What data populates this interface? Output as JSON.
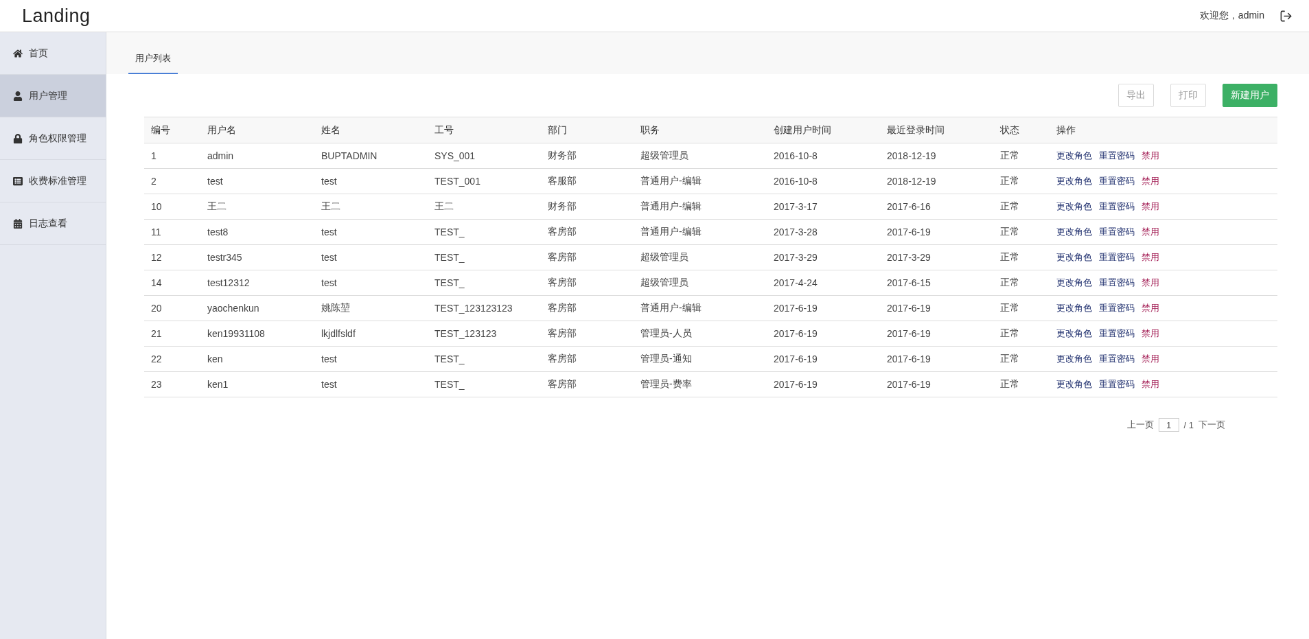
{
  "header": {
    "logo": "Landing",
    "welcome": "欢迎您，admin"
  },
  "sidebar": {
    "items": [
      {
        "label": "首页",
        "selected": false
      },
      {
        "label": "用户管理",
        "selected": true
      },
      {
        "label": "角色权限管理",
        "selected": false
      },
      {
        "label": "收费标准管理",
        "selected": false
      },
      {
        "label": "日志查看",
        "selected": false
      }
    ]
  },
  "tabs": [
    {
      "label": "用户列表",
      "selected": true
    }
  ],
  "toolbar": {
    "buttons": [
      {
        "label": "导出",
        "kind": "default"
      },
      {
        "label": "打印",
        "kind": "default"
      },
      {
        "label": "新建用户",
        "kind": "primary"
      }
    ]
  },
  "table": {
    "columns": [
      "编号",
      "用户名",
      "姓名",
      "工号",
      "部门",
      "职务",
      "创建用户时间",
      "最近登录时间",
      "状态",
      "操作"
    ],
    "rows": [
      {
        "cells": [
          "1",
          "admin",
          "BUPTADMIN",
          "SYS_001",
          "财务部",
          "超级管理员",
          "2016-10-8",
          "2018-12-19",
          "正常"
        ],
        "actions": [
          {
            "label": "更改角色",
            "kind": "normal"
          },
          {
            "label": "重置密码",
            "kind": "normal"
          },
          {
            "label": "禁用",
            "kind": "danger"
          }
        ]
      },
      {
        "cells": [
          "2",
          "test",
          "test",
          "TEST_001",
          "客服部",
          "普通用户-编辑",
          "2016-10-8",
          "2018-12-19",
          "正常"
        ],
        "actions": [
          {
            "label": "更改角色",
            "kind": "normal"
          },
          {
            "label": "重置密码",
            "kind": "normal"
          },
          {
            "label": "禁用",
            "kind": "danger"
          }
        ]
      },
      {
        "cells": [
          "10",
          "王二",
          "王二",
          "王二",
          "财务部",
          "普通用户-编辑",
          "2017-3-17",
          "2017-6-16",
          "正常"
        ],
        "actions": [
          {
            "label": "更改角色",
            "kind": "normal"
          },
          {
            "label": "重置密码",
            "kind": "normal"
          },
          {
            "label": "禁用",
            "kind": "danger"
          }
        ]
      },
      {
        "cells": [
          "11",
          "test8",
          "test",
          "TEST_",
          "客房部",
          "普通用户-编辑",
          "2017-3-28",
          "2017-6-19",
          "正常"
        ],
        "actions": [
          {
            "label": "更改角色",
            "kind": "normal"
          },
          {
            "label": "重置密码",
            "kind": "normal"
          },
          {
            "label": "禁用",
            "kind": "danger"
          }
        ]
      },
      {
        "cells": [
          "12",
          "testr345",
          "test",
          "TEST_",
          "客房部",
          "超级管理员",
          "2017-3-29",
          "2017-3-29",
          "正常"
        ],
        "actions": [
          {
            "label": "更改角色",
            "kind": "normal"
          },
          {
            "label": "重置密码",
            "kind": "normal"
          },
          {
            "label": "禁用",
            "kind": "danger"
          }
        ]
      },
      {
        "cells": [
          "14",
          "test12312",
          "test",
          "TEST_",
          "客房部",
          "超级管理员",
          "2017-4-24",
          "2017-6-15",
          "正常"
        ],
        "actions": [
          {
            "label": "更改角色",
            "kind": "normal"
          },
          {
            "label": "重置密码",
            "kind": "normal"
          },
          {
            "label": "禁用",
            "kind": "danger"
          }
        ]
      },
      {
        "cells": [
          "20",
          "yaochenkun",
          "姚陈堃",
          "TEST_123123123",
          "客房部",
          "普通用户-编辑",
          "2017-6-19",
          "2017-6-19",
          "正常"
        ],
        "actions": [
          {
            "label": "更改角色",
            "kind": "normal"
          },
          {
            "label": "重置密码",
            "kind": "normal"
          },
          {
            "label": "禁用",
            "kind": "danger"
          }
        ]
      },
      {
        "cells": [
          "21",
          "ken19931108",
          "lkjdlfsldf",
          "TEST_123123",
          "客房部",
          "管理员-人员",
          "2017-6-19",
          "2017-6-19",
          "正常"
        ],
        "actions": [
          {
            "label": "更改角色",
            "kind": "normal"
          },
          {
            "label": "重置密码",
            "kind": "normal"
          },
          {
            "label": "禁用",
            "kind": "danger"
          }
        ]
      },
      {
        "cells": [
          "22",
          "ken",
          "test",
          "TEST_",
          "客房部",
          "管理员-通知",
          "2017-6-19",
          "2017-6-19",
          "正常"
        ],
        "actions": [
          {
            "label": "更改角色",
            "kind": "normal"
          },
          {
            "label": "重置密码",
            "kind": "normal"
          },
          {
            "label": "禁用",
            "kind": "danger"
          }
        ]
      },
      {
        "cells": [
          "23",
          "ken1",
          "test",
          "TEST_",
          "客房部",
          "管理员-费率",
          "2017-6-19",
          "2017-6-19",
          "正常"
        ],
        "actions": [
          {
            "label": "更改角色",
            "kind": "normal"
          },
          {
            "label": "重置密码",
            "kind": "normal"
          },
          {
            "label": "禁用",
            "kind": "danger"
          }
        ]
      }
    ]
  },
  "pagination": {
    "prev": "上一页",
    "page": "1",
    "total": "/ 1",
    "next": "下一页"
  }
}
